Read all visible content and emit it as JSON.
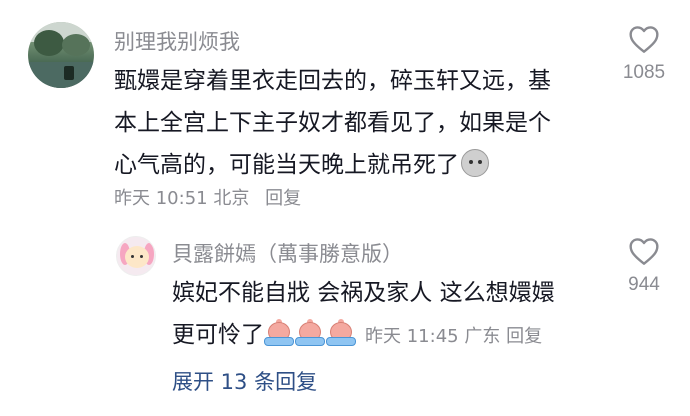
{
  "comments": [
    {
      "username": "别理我别烦我",
      "lines": [
        "甄嬛是穿着里衣走回去的，碎玉轩又远，基",
        "本上全宫上下主子奴才都看见了，如果是个",
        "心气高的，可能当天晚上就吊死了"
      ],
      "emoji": "stone-face-emoji",
      "time": "昨天 10:51",
      "location": "北京",
      "reply_label": "回复",
      "likes": "1085"
    },
    {
      "username": "貝露餅嫣（萬事勝意版）",
      "lines": [
        "嫔妃不能自戕 会祸及家人 这么想嬛嬛",
        "更可怜了"
      ],
      "emoji": "crying-emoji",
      "time": "昨天 11:45",
      "location": "广东",
      "reply_label": "回复",
      "likes": "944"
    }
  ],
  "expand_replies": "展开 13 条回复",
  "colors": {
    "text": "#161823",
    "secondary": "#8a8b91",
    "link": "#2e4f86"
  },
  "icons": [
    "heart-icon"
  ]
}
